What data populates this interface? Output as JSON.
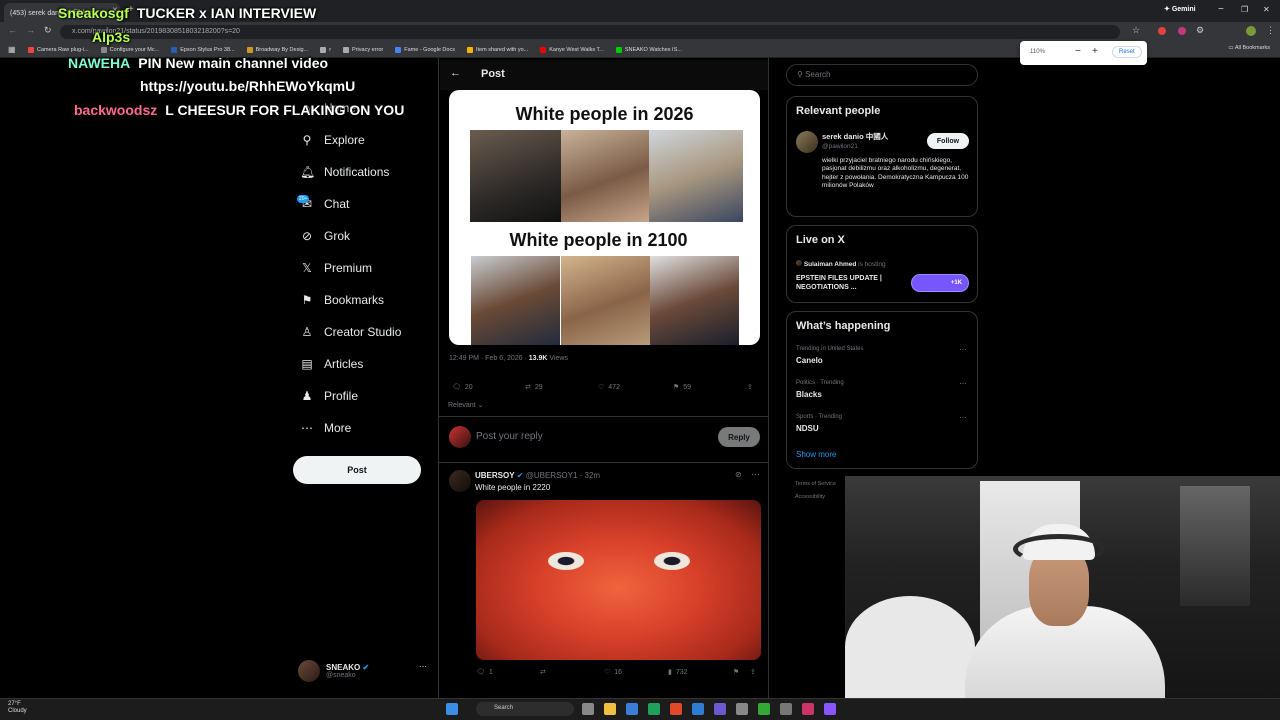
{
  "browser": {
    "tab_title": "(453) serek danio 中國人 on X",
    "url": "x.com/pawilon21/status/2019830851803218200?s=20",
    "gemini_label": "Gemini",
    "all_bookmarks": "All Bookmarks",
    "bookmarks": [
      {
        "label": "Camera Raw plug-i...",
        "color": "#e44"
      },
      {
        "label": "Configure your Mc...",
        "color": "#888"
      },
      {
        "label": "Epson Stylus Pro 38...",
        "color": "#2a5db0"
      },
      {
        "label": "Broadway By Desig...",
        "color": "#c92"
      },
      {
        "label": "r",
        "color": "#aaa"
      },
      {
        "label": "Privacy error",
        "color": "#aaa"
      },
      {
        "label": "Fame - Google Docs",
        "color": "#4285f4"
      },
      {
        "label": "Item shared with yo...",
        "color": "#f4b400"
      },
      {
        "label": "Kanye West Walks T...",
        "color": "#e00"
      },
      {
        "label": "SNEAKO Watches IS...",
        "color": "#0c0"
      }
    ],
    "zoom": {
      "value": "110%",
      "minus": "−",
      "plus": "+",
      "reset": "Reset"
    }
  },
  "chat_overlay": [
    {
      "user": "Sneakosgf",
      "user_color": "#b6ff4f",
      "message": "TUCKER x IAN INTERVIEW"
    },
    {
      "user": "Alp3s",
      "user_color": "#b6ff4f",
      "message": ""
    },
    {
      "user": "NAWEHA",
      "user_color": "#7fffd4",
      "message": "PIN New main channel video"
    },
    {
      "user": "",
      "user_color": "#fff",
      "message": "https://youtu.be/RhhEWoYkqmU"
    },
    {
      "user": "backwoodsz",
      "user_color": "#ff6b8f",
      "message": "L CHEESUR FOR FLAKING ON YOU"
    }
  ],
  "sidebar": {
    "items": [
      {
        "label": "Home",
        "icon": "home-icon"
      },
      {
        "label": "Explore",
        "icon": "search-icon"
      },
      {
        "label": "Notifications",
        "icon": "bell-icon"
      },
      {
        "label": "Chat",
        "icon": "mail-icon"
      },
      {
        "label": "Grok",
        "icon": "grok-icon"
      },
      {
        "label": "Premium",
        "icon": "x-logo-icon"
      },
      {
        "label": "Bookmarks",
        "icon": "bookmark-icon"
      },
      {
        "label": "Creator Studio",
        "icon": "creator-icon"
      },
      {
        "label": "Articles",
        "icon": "articles-icon"
      },
      {
        "label": "Profile",
        "icon": "person-icon"
      },
      {
        "label": "More",
        "icon": "more-circle-icon"
      }
    ],
    "chat_badge": "20+",
    "post_button": "Post",
    "account": {
      "name": "SNEAKO",
      "handle": "@sneako"
    }
  },
  "post": {
    "header": "Post",
    "meme_top": "White people in 2026",
    "meme_bottom": "White people in 2100",
    "time": "12:49 PM · Feb 6, 2026 ·",
    "views_count": "13.9K",
    "views_label": "Views",
    "stats": {
      "replies": "20",
      "reposts": "29",
      "likes": "472",
      "bookmarks": "59"
    },
    "sort": "Relevant",
    "reply_placeholder": "Post your reply",
    "reply_button": "Reply"
  },
  "reply_tweet": {
    "name": "UBERSOY",
    "handle_time": "@UBERSOY1 · 32m",
    "text": "White people in 2220",
    "stats": {
      "replies": "1",
      "reposts": "",
      "likes": "16",
      "views": "732"
    }
  },
  "right": {
    "search_placeholder": "Search",
    "relevant": {
      "title": "Relevant people",
      "name": "serek danio 中國人",
      "handle": "@pawilon21",
      "follow": "Follow",
      "bio": "wielki przyjaciel bratniego narodu chińskiego, pasjonat debilizmu oraz alkoholizmu, degenerat, hejter z powołania. Demokratyczna Kampucza 100 milionów Polaków"
    },
    "live": {
      "title": "Live on X",
      "host": "Sulaiman Ahmed",
      "hosting": "is hosting",
      "space_title": "EPSTEIN FILES UPDATE | NEGOTIATIONS ...",
      "listeners": "+1K"
    },
    "happening": {
      "title": "What’s happening",
      "trends": [
        {
          "meta": "Trending in United States",
          "name": "Canelo"
        },
        {
          "meta": "Politics · Trending",
          "name": "Blacks"
        },
        {
          "meta": "Sports · Trending",
          "name": "NDSU"
        }
      ],
      "show_more": "Show more"
    },
    "footer": [
      "Terms of Service",
      "Accessibility"
    ]
  },
  "taskbar": {
    "weather_temp": "27°F",
    "weather_desc": "Cloudy",
    "search": "Search"
  }
}
